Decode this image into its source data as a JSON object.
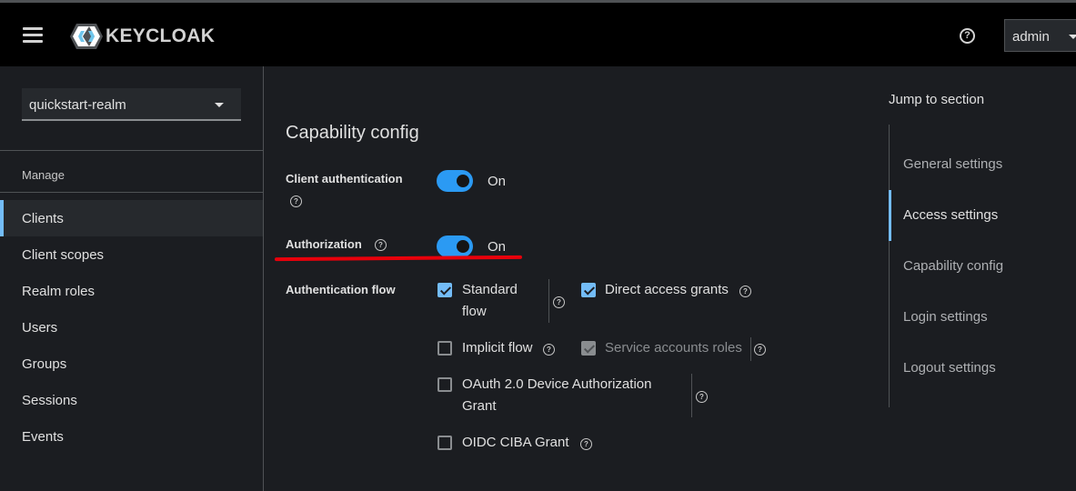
{
  "header": {
    "logo_text": "KEYCLOAK",
    "user": "admin"
  },
  "sidebar": {
    "realm": "quickstart-realm",
    "section": "Manage",
    "items": [
      {
        "label": "Clients",
        "active": true
      },
      {
        "label": "Client scopes"
      },
      {
        "label": "Realm roles"
      },
      {
        "label": "Users"
      },
      {
        "label": "Groups"
      },
      {
        "label": "Sessions"
      },
      {
        "label": "Events"
      }
    ]
  },
  "main": {
    "title": "Capability config",
    "client_auth": {
      "label": "Client authentication",
      "state": "On"
    },
    "authorization": {
      "label": "Authorization",
      "state": "On"
    },
    "auth_flow": {
      "label": "Authentication flow",
      "options": [
        {
          "line1": "Standard",
          "line2": "flow",
          "checked": true
        },
        {
          "label": "Direct access grants",
          "checked": true
        },
        {
          "label": "Implicit flow",
          "checked": false
        },
        {
          "label": "Service accounts roles",
          "checked": true,
          "disabled": true
        },
        {
          "line1": "OAuth 2.0 Device Authorization",
          "line2": "Grant",
          "checked": false
        },
        {
          "label": "OIDC CIBA Grant",
          "checked": false
        }
      ]
    }
  },
  "jump": {
    "title": "Jump to section",
    "items": [
      {
        "label": "General settings"
      },
      {
        "label": "Access settings",
        "active": true
      },
      {
        "label": "Capability config"
      },
      {
        "label": "Login settings"
      },
      {
        "label": "Logout settings"
      }
    ]
  },
  "colors": {
    "accent": "#73bcf7",
    "switch_on": "#2b9af3",
    "annotation": "#e8000b"
  }
}
